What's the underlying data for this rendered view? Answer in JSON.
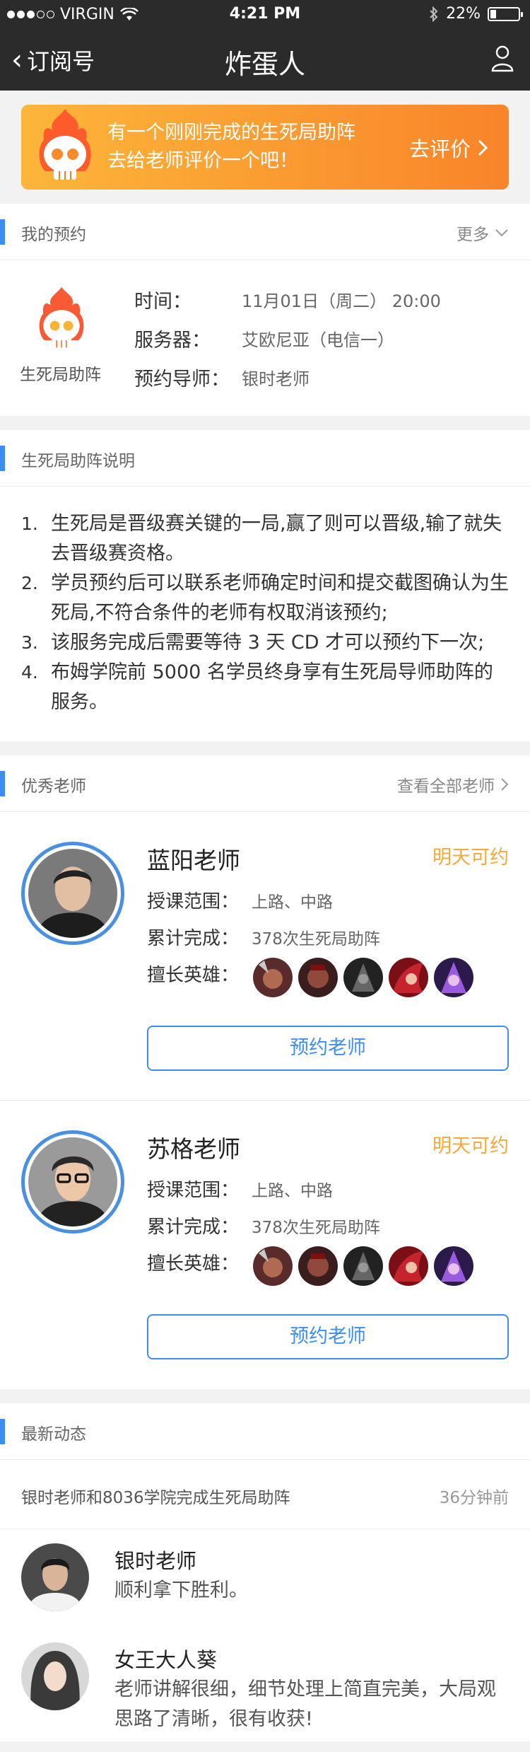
{
  "status_bar": {
    "carrier": "VIRGIN",
    "time": "4:21 PM",
    "battery": "22%",
    "battery_level": 0.22
  },
  "nav": {
    "back_label": "订阅号",
    "title": "炸蛋人"
  },
  "banner": {
    "line1": "有一个刚刚完成的生死局助阵",
    "line2": "去给老师评价一个吧！",
    "cta": "去评价"
  },
  "booking_section": {
    "title": "我的预约",
    "more": "更多",
    "service_name": "生死局助阵",
    "rows": [
      {
        "label": "时间：",
        "value": "11月01日（周二） 20:00"
      },
      {
        "label": "服务器：",
        "value": "艾欧尼亚（电信一）"
      },
      {
        "label": "预约导师：",
        "value": "银时老师"
      }
    ]
  },
  "rules_section": {
    "title": "生死局助阵说明",
    "items": [
      {
        "num": "1.",
        "text": "生死局是晋级赛关键的一局,赢了则可以晋级,输了就失去晋级赛资格。"
      },
      {
        "num": "2.",
        "text": "学员预约后可以联系老师确定时间和提交截图确认为生死局,不符合条件的老师有权取消该预约;"
      },
      {
        "num": "3.",
        "text": "该服务完成后需要等待 3 天 CD 才可以预约下一次;"
      },
      {
        "num": "4.",
        "text": "布姆学院前 5000 名学员终身享有生死局导师助阵的服务。"
      }
    ]
  },
  "teachers_section": {
    "title": "优秀老师",
    "more": "查看全部老师",
    "teachers": [
      {
        "name": "蓝阳老师",
        "availability": "明天可约",
        "range_label": "授课范围：",
        "range": "上路、中路",
        "done_label": "累计完成：",
        "done": "378次生死局助阵",
        "heroes_label": "擅长英雄：",
        "book": "预约老师"
      },
      {
        "name": "苏格老师",
        "availability": "明天可约",
        "range_label": "授课范围：",
        "range": "上路、中路",
        "done_label": "累计完成：",
        "done": "378次生死局助阵",
        "heroes_label": "擅长英雄：",
        "book": "预约老师"
      }
    ]
  },
  "news_section": {
    "title": "最新动态",
    "summary": "银时老师和8036学院完成生死局助阵",
    "ago": "36分钟前",
    "comments": [
      {
        "name": "银时老师",
        "text": "顺利拿下胜利。"
      },
      {
        "name": "女王大人葵",
        "text": "老师讲解很细，细节处理上简直完美，大局观思路了清晰，很有收获!"
      }
    ]
  },
  "colors": {
    "accent": "#3d8ef0",
    "orange": "#f7a93a",
    "nav_bg": "#2b2b2b"
  }
}
